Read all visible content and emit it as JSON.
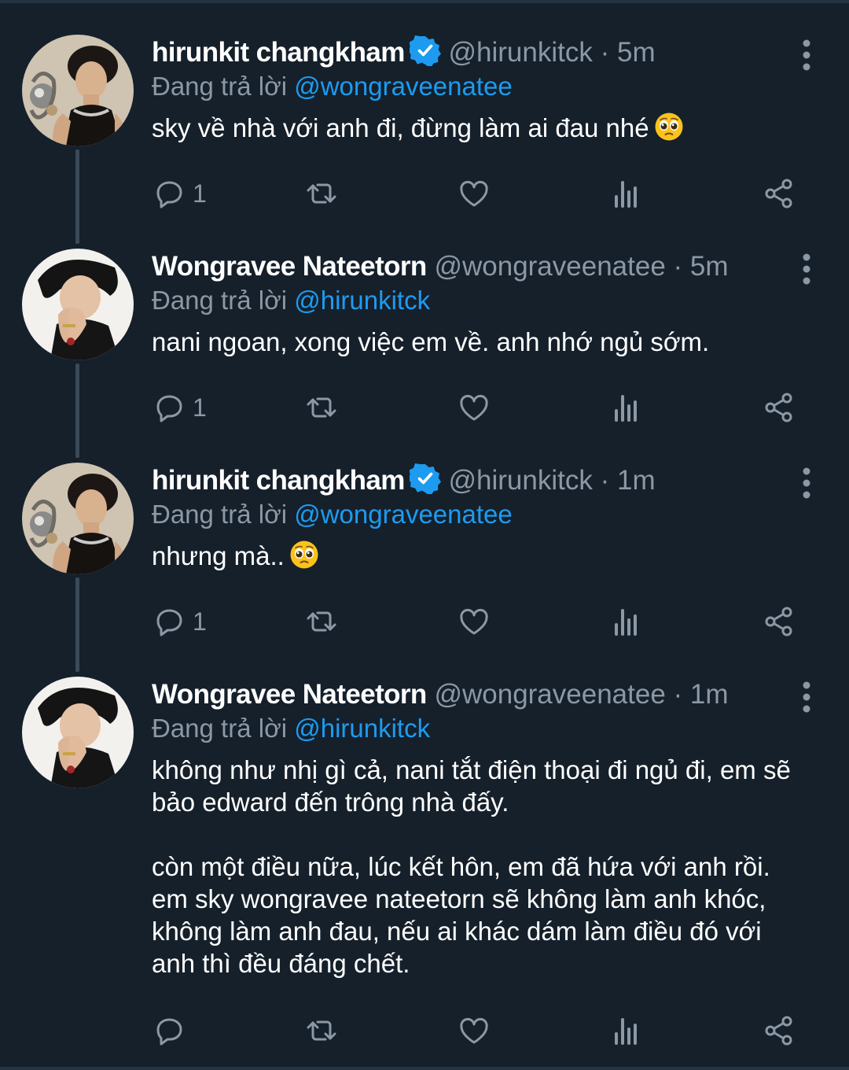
{
  "tweets": [
    {
      "name": "hirunkit changkham",
      "verified": true,
      "handle": "@hirunkitck",
      "separator": "·",
      "time": "5m",
      "replying_prefix": "Đang trả lời",
      "replying_to": "@wongraveenatee",
      "text": [
        "sky về nhà với anh đi, đừng làm ai đau nhé"
      ],
      "emoji": "pleading-face-emoji",
      "reply_count": "1"
    },
    {
      "name": "Wongravee Nateetorn",
      "verified": false,
      "handle": "@wongraveenatee",
      "separator": "·",
      "time": "5m",
      "replying_prefix": "Đang trả lời",
      "replying_to": "@hirunkitck",
      "text": [
        "nani ngoan, xong việc em về. anh nhớ ngủ sớm."
      ],
      "reply_count": "1"
    },
    {
      "name": "hirunkit changkham",
      "verified": true,
      "handle": "@hirunkitck",
      "separator": "·",
      "time": "1m",
      "replying_prefix": "Đang trả lời",
      "replying_to": "@wongraveenatee",
      "text": [
        "nhưng mà.."
      ],
      "emoji": "pleading-face-emoji",
      "reply_count": "1"
    },
    {
      "name": "Wongravee Nateetorn",
      "verified": false,
      "handle": "@wongraveenatee",
      "separator": "·",
      "time": "1m",
      "replying_prefix": "Đang trả lời",
      "replying_to": "@hirunkitck",
      "text": [
        "không như nhị gì cả, nani tắt điện thoại đi ngủ đi, em sẽ",
        "bảo edward đến trông nhà đấy.",
        "",
        "còn một điều nữa, lúc kết hôn, em đã hứa với anh rồi.",
        "em sky wongravee nateetorn sẽ không làm anh khóc,",
        "không làm anh đau, nếu ai khác dám làm điều đó với",
        "anh thì đều đáng chết."
      ],
      "reply_count": ""
    }
  ],
  "colors": {
    "background": "#15202b",
    "text": "#ffffff",
    "secondary": "#8b98a5",
    "accent": "#1d9bf0",
    "thread_line": "#3b4a58"
  },
  "icons": [
    "reply-icon",
    "retweet-icon",
    "like-icon",
    "views-icon",
    "share-icon",
    "more-icon",
    "verified-badge-icon"
  ]
}
